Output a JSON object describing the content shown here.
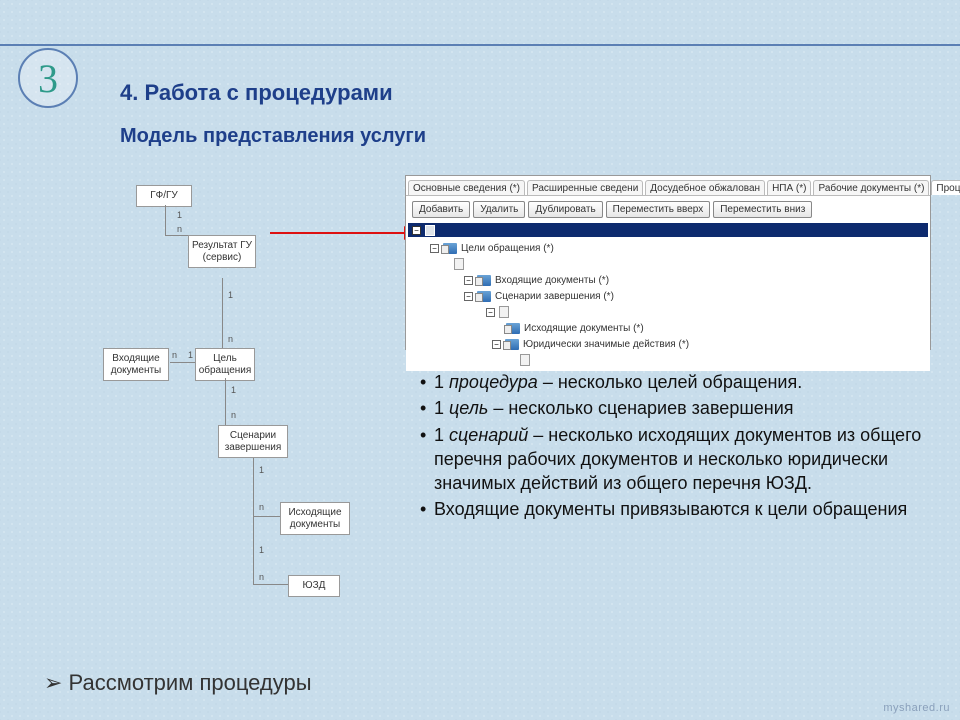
{
  "badge": "3",
  "title": "4. Работа с процедурами",
  "subtitle": "Модель представления услуги",
  "footer": "Рассмотрим процедуры",
  "watermark": "myshared.ru",
  "diagram": {
    "b1": "ГФ/ГУ",
    "b2": "Результат\nГУ\n(сервис)",
    "b3": "Цель\nобращения",
    "b3l": "Входящие\nдокументы",
    "b4": "Сценарии\nзавершения",
    "b5": "Исходящие\nдокументы",
    "b6": "ЮЗД"
  },
  "tabs": [
    "Основные сведения (*)",
    "Расширенные сведени",
    "Досудебное обжалован",
    "НПА (*)",
    "Рабочие документы (*)",
    "Процедуры(*)"
  ],
  "active_tab": 5,
  "buttons": [
    "Добавить",
    "Удалить",
    "Дублировать",
    "Переместить вверх",
    "Переместить вниз"
  ],
  "tree": {
    "n1": "Цели обращения (*)",
    "n2": "Входящие документы (*)",
    "n3": "Сценарии завершения (*)",
    "n4": "Исходящие документы (*)",
    "n5": "Юридически значимые действия (*)"
  },
  "bullets": [
    {
      "pre": "1 ",
      "em": "процедура",
      "post": " – несколько целей обращения."
    },
    {
      "pre": "1 ",
      "em": "цель",
      "post": " – несколько сценариев завершения"
    },
    {
      "pre": "1 ",
      "em": "сценарий",
      "post": " – несколько исходящих документов из общего перечня рабочих документов и несколько юридически значимых действий из общего перечня ЮЗД."
    },
    {
      "pre": "",
      "em": "",
      "post": "Входящие документы привязываются к цели обращения"
    }
  ]
}
